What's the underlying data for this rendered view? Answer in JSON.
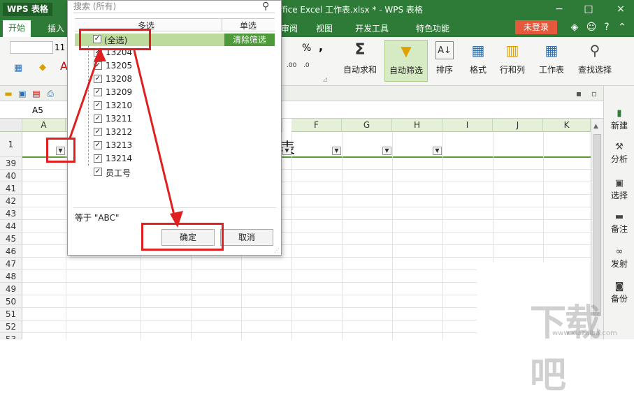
{
  "titlebar": {
    "logo": "WPS 表格",
    "title": "ffice Excel 工作表.xlsx * - WPS 表格",
    "min": "−",
    "max": "□",
    "close": "×"
  },
  "tabs": {
    "start": "开始",
    "insert": "插入",
    "review": "审阅",
    "view": "视图",
    "dev": "开发工具",
    "special": "特色功能",
    "login": "未登录"
  },
  "ribbon": {
    "font_size": "11",
    "percent": "%",
    "comma": ",",
    "autosum": "自动求和",
    "autofilter": "自动筛选",
    "sort": "排序",
    "format": "格式",
    "rowcol": "行和列",
    "sheet": "工作表",
    "findselect": "查找选择"
  },
  "formula": {
    "cellref": "A5"
  },
  "grid": {
    "columns": [
      "A",
      "F",
      "G",
      "H",
      "I",
      "J",
      "K"
    ],
    "rows": [
      "1",
      "39",
      "40",
      "41",
      "42",
      "43",
      "44",
      "45",
      "46",
      "47",
      "48",
      "49",
      "50",
      "51",
      "52",
      "53"
    ],
    "title_cell": "表"
  },
  "sidebar": {
    "new": "新建",
    "analyze": "分析",
    "select": "选择",
    "note": "备注",
    "share": "发射",
    "backup": "备份"
  },
  "popup": {
    "search_placeholder": "搜索 (所有)",
    "mode_multi": "多选",
    "mode_single": "单选",
    "clear_filter": "清除筛选",
    "items": [
      "(全选)",
      "13204",
      "13205",
      "13208",
      "13209",
      "13210",
      "13211",
      "13212",
      "13213",
      "13214",
      "员工号"
    ],
    "check_mark": "✓",
    "equals_text": "等于 \"ABC\"",
    "ok": "确定",
    "cancel": "取消"
  },
  "watermark": {
    "main": "下载吧",
    "sub": "www.xiazaiba.com"
  }
}
